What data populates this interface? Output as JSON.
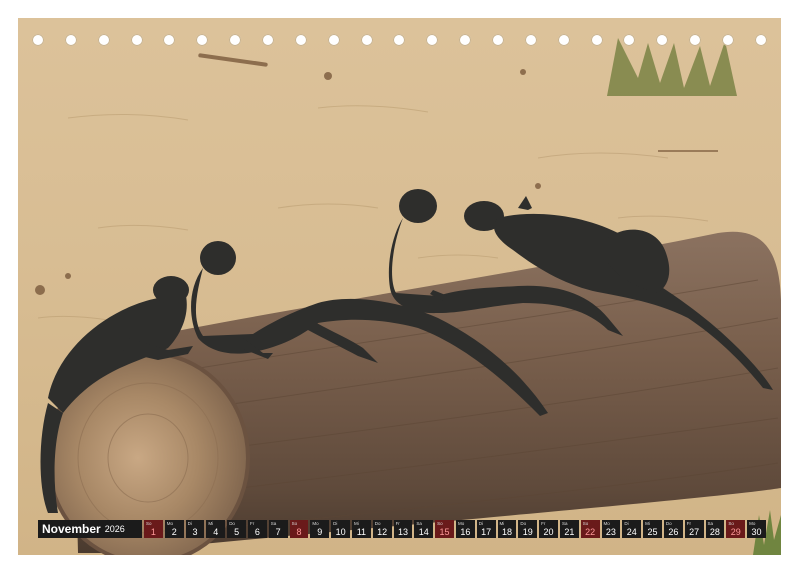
{
  "calendar": {
    "month": "November",
    "year": "2026",
    "days": [
      {
        "wd": "So",
        "n": "1",
        "sun": true
      },
      {
        "wd": "Mo",
        "n": "2"
      },
      {
        "wd": "Di",
        "n": "3"
      },
      {
        "wd": "Mi",
        "n": "4"
      },
      {
        "wd": "Do",
        "n": "5"
      },
      {
        "wd": "Fr",
        "n": "6"
      },
      {
        "wd": "Sa",
        "n": "7"
      },
      {
        "wd": "So",
        "n": "8",
        "sun": true
      },
      {
        "wd": "Mo",
        "n": "9"
      },
      {
        "wd": "Di",
        "n": "10"
      },
      {
        "wd": "Mi",
        "n": "11"
      },
      {
        "wd": "Do",
        "n": "12"
      },
      {
        "wd": "Fr",
        "n": "13"
      },
      {
        "wd": "Sa",
        "n": "14"
      },
      {
        "wd": "So",
        "n": "15",
        "sun": true
      },
      {
        "wd": "Mo",
        "n": "16"
      },
      {
        "wd": "Di",
        "n": "17"
      },
      {
        "wd": "Mi",
        "n": "18"
      },
      {
        "wd": "Do",
        "n": "19"
      },
      {
        "wd": "Fr",
        "n": "20"
      },
      {
        "wd": "Sa",
        "n": "21"
      },
      {
        "wd": "So",
        "n": "22",
        "sun": true
      },
      {
        "wd": "Mo",
        "n": "23"
      },
      {
        "wd": "Di",
        "n": "24"
      },
      {
        "wd": "Mi",
        "n": "25"
      },
      {
        "wd": "Do",
        "n": "26"
      },
      {
        "wd": "Fr",
        "n": "27"
      },
      {
        "wd": "Sa",
        "n": "28"
      },
      {
        "wd": "So",
        "n": "29",
        "sun": true
      },
      {
        "wd": "Mo",
        "n": "30"
      }
    ]
  },
  "colors": {
    "sand": "#d8bd93",
    "log": "#7d6451",
    "iguana": "#2e2e2c",
    "bar": "#1b1b1b",
    "sunday": "#6a1a1a"
  }
}
